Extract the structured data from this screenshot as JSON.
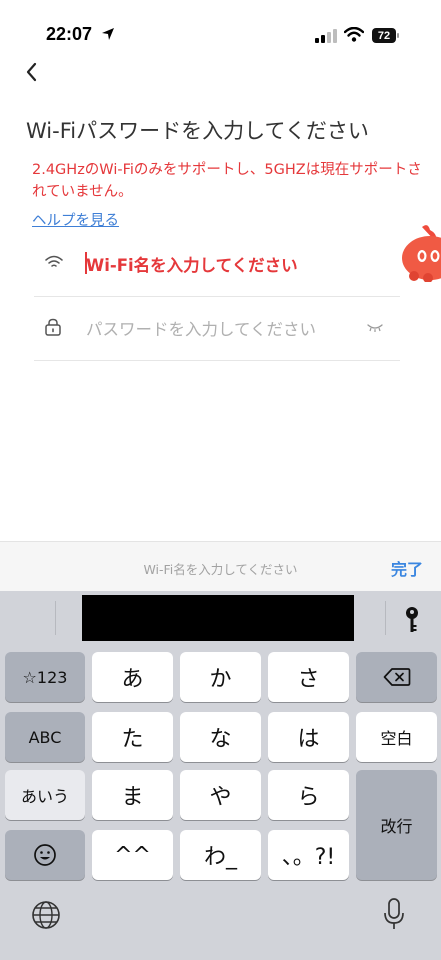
{
  "status_bar": {
    "time": "22:07",
    "battery": "72",
    "icons": [
      "location-arrow-icon",
      "cellular-signal-icon",
      "wifi-icon",
      "battery-icon"
    ]
  },
  "nav": {
    "back_icon": "chevron-left-icon"
  },
  "page": {
    "title": "Wi-Fiパスワードを入力してください",
    "warning": "2.4GHzのWi-Fiのみをサポートし、5GHZは現在サポートされていません。",
    "help_link": "ヘルプを見る"
  },
  "form": {
    "wifi_name": {
      "value": "Wi-Fi名を入力してください",
      "icon": "wifi-icon"
    },
    "password": {
      "placeholder": "パスワードを入力してください",
      "icon": "lock-icon",
      "toggle_icon": "eye-closed-icon"
    }
  },
  "accessory_bar": {
    "placeholder": "Wi-Fi名を入力してください",
    "done": "完了"
  },
  "keyboard": {
    "row1": {
      "mode": "☆123",
      "keys": [
        "あ",
        "か",
        "さ"
      ],
      "action_icon": "delete-icon"
    },
    "row2": {
      "mode": "ABC",
      "keys": [
        "た",
        "な",
        "は"
      ],
      "action": "空白"
    },
    "row3": {
      "mode": "あいう",
      "keys": [
        "ま",
        "や",
        "ら"
      ],
      "action": "改行"
    },
    "row4": {
      "mode_icon": "emoji-icon",
      "keys": [
        "^^",
        "わ_",
        "、。?!"
      ]
    },
    "bottom": {
      "left_icon": "globe-icon",
      "right_icon": "microphone-icon"
    },
    "candidate_icon": "key-icon"
  },
  "colors": {
    "accent_red": "#e5383b",
    "link_blue": "#3f7fd6",
    "done_blue": "#3a86e0",
    "keyboard_bg": "#d1d3d9"
  }
}
